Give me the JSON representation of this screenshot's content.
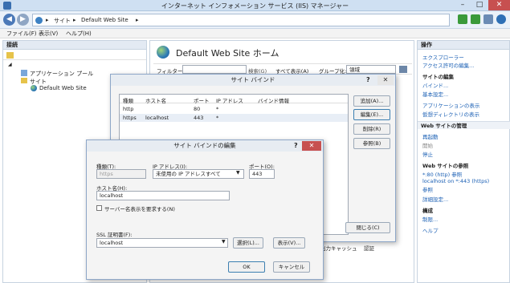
{
  "window": {
    "title": "インターネット インフォメーション サービス (IIS) マネージャー",
    "minimize": "–",
    "maximize": "□",
    "close": "✕"
  },
  "address": {
    "crumbs": [
      "▸",
      "サイト",
      "▸",
      "Default Web Site",
      "▸"
    ]
  },
  "menubar": {
    "file": "ファイル(F)",
    "view": "表示(V)",
    "help": "ヘルプ(H)"
  },
  "left": {
    "header": "接続",
    "tree": {
      "root": "◢",
      "app_pools": "アプリケーション プール",
      "sites": "サイト",
      "site": "Default Web Site"
    }
  },
  "center": {
    "title": "Default Web Site ホーム",
    "filter_label": "フィルター:",
    "search": "検索(G)",
    "show_all": "すべて表示(A)",
    "group_label": "グループ化:",
    "group_value": "領域",
    "bottom_items": [
      "出力キャッシュ",
      "認証"
    ]
  },
  "right": {
    "header": "操作",
    "explore": "エクスプローラー",
    "edit_perms": "アクセス許可の編集...",
    "edit_site_head": "サイトの編集",
    "bindings": "バインド...",
    "basic_settings": "基本設定...",
    "view_apps": "アプリケーションの表示",
    "view_vdirs": "仮想ディレクトリの表示",
    "manage_head": "Web サイトの管理",
    "restart": "再起動",
    "start": "開始",
    "stop": "停止",
    "browse_head": "Web サイトの参照",
    "browse_http": "*:80 (http) 参照",
    "browse_https": "localhost on *:443 (https)",
    "browse_https2": "参照",
    "advanced": "詳細設定...",
    "config_head": "構成",
    "limits": "制限...",
    "help": "ヘルプ"
  },
  "bindings_dialog": {
    "title": "サイト バインド",
    "help_btn": "?",
    "close_btn": "✕",
    "columns": [
      "種類",
      "ホスト名",
      "ポート",
      "IP アドレス",
      "バインド情報"
    ],
    "rows": [
      [
        "http",
        "",
        "80",
        "*",
        ""
      ],
      [
        "https",
        "localhost",
        "443",
        "*",
        ""
      ]
    ],
    "add": "追加(A)...",
    "edit": "編集(E)...",
    "remove": "削除(R)",
    "browse": "参照(B)",
    "close": "閉じる(C)"
  },
  "edit_dialog": {
    "title": "サイト バインドの編集",
    "help_btn": "?",
    "close_btn": "✕",
    "type_label": "種類(T):",
    "type_value": "https",
    "ip_label": "IP アドレス(I):",
    "ip_value": "未使用の IP アドレスすべて",
    "port_label": "ポート(O):",
    "port_value": "443",
    "host_label": "ホスト名(H):",
    "host_value": "localhost",
    "sni_label": "サーバー名表示を要求する(N)",
    "ssl_label": "SSL 証明書(F):",
    "ssl_value": "localhost",
    "select": "選択(L)...",
    "view": "表示(V)...",
    "ok": "OK",
    "cancel": "キャンセル"
  }
}
